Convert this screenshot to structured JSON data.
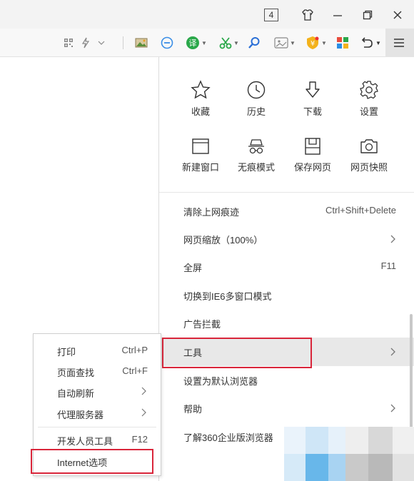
{
  "titlebar": {
    "tab_count": "4",
    "buttons": [
      {
        "name": "skin-icon"
      },
      {
        "name": "minimize-icon"
      },
      {
        "name": "restore-icon"
      },
      {
        "name": "close-icon"
      }
    ]
  },
  "toolbar": {
    "icons": [
      "qr-code-icon",
      "lightning-icon",
      "chevron-down-icon",
      "screenshot-icon",
      "no-entry-icon",
      "translate-icon",
      "scissors-icon",
      "search-icon",
      "image-icon",
      "shield-icon",
      "apps-icon",
      "undo-icon",
      "menu-icon"
    ]
  },
  "menu": {
    "grid": [
      {
        "label": "收藏",
        "icon": "star-icon"
      },
      {
        "label": "历史",
        "icon": "clock-icon"
      },
      {
        "label": "下载",
        "icon": "download-icon"
      },
      {
        "label": "设置",
        "icon": "gear-icon"
      },
      {
        "label": "新建窗口",
        "icon": "new-window-icon"
      },
      {
        "label": "无痕模式",
        "icon": "incognito-icon"
      },
      {
        "label": "保存网页",
        "icon": "save-icon"
      },
      {
        "label": "网页快照",
        "icon": "camera-icon"
      }
    ],
    "items": [
      {
        "label": "清除上网痕迹",
        "shortcut": "Ctrl+Shift+Delete"
      },
      {
        "label": "网页缩放（100%）",
        "has_submenu": true
      },
      {
        "label": "全屏",
        "shortcut": "F11"
      },
      {
        "label": "切换到IE6多窗口模式"
      },
      {
        "label": "广告拦截"
      },
      {
        "label": "工具",
        "has_submenu": true,
        "highlighted": true
      },
      {
        "label": "设置为默认浏览器"
      },
      {
        "label": "帮助",
        "has_submenu": true
      },
      {
        "label": "了解360企业版浏览器"
      }
    ]
  },
  "submenu": {
    "items": [
      {
        "label": "打印",
        "shortcut": "Ctrl+P"
      },
      {
        "label": "页面查找",
        "shortcut": "Ctrl+F"
      },
      {
        "label": "自动刷新",
        "has_submenu": true
      },
      {
        "label": "代理服务器",
        "has_submenu": true
      },
      {
        "label": "开发人员工具",
        "shortcut": "F12"
      },
      {
        "label": "Internet选项",
        "highlighted": true
      }
    ]
  },
  "colors": {
    "highlight_border": "#d9253a",
    "hover_bg": "#e8e8e8"
  }
}
